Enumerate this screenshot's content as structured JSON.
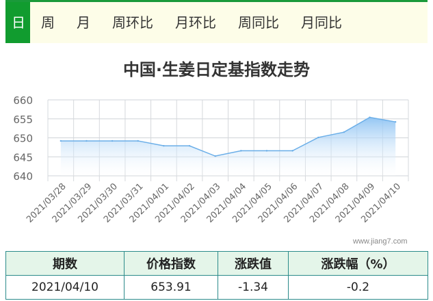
{
  "tabs": [
    "日",
    "周",
    "月",
    "周环比",
    "月环比",
    "周同比",
    "月同比"
  ],
  "active_tab": 0,
  "watermark": "www.jiang7.com",
  "colors": {
    "accent": "#119c2f",
    "line": "#6aaee8",
    "area_top": "#8ec3f3",
    "table_header_bg": "#e4f5e9",
    "table_border": "#2a8a8a"
  },
  "chart_data": {
    "type": "area",
    "title": "中国·生姜日定基指数走势",
    "xlabel": "",
    "ylabel": "",
    "ylim": [
      640,
      660
    ],
    "yticks": [
      640,
      645,
      650,
      655,
      660
    ],
    "grid": true,
    "categories": [
      "2021/03/28",
      "2021/03/29",
      "2021/03/30",
      "2021/03/31",
      "2021/04/01",
      "2021/04/02",
      "2021/04/03",
      "2021/04/04",
      "2021/04/05",
      "2021/04/06",
      "2021/04/07",
      "2021/04/08",
      "2021/04/09",
      "2021/04/10"
    ],
    "values": [
      649.2,
      649.2,
      649.2,
      649.2,
      647.9,
      647.9,
      645.2,
      646.6,
      646.6,
      646.6,
      650.1,
      651.5,
      655.4,
      654.2
    ]
  },
  "summary": {
    "headers": [
      "期数",
      "价格指数",
      "涨跌值",
      "涨跌幅（%）"
    ],
    "row": [
      "2021/04/10",
      "653.91",
      "-1.34",
      "-0.2"
    ]
  }
}
